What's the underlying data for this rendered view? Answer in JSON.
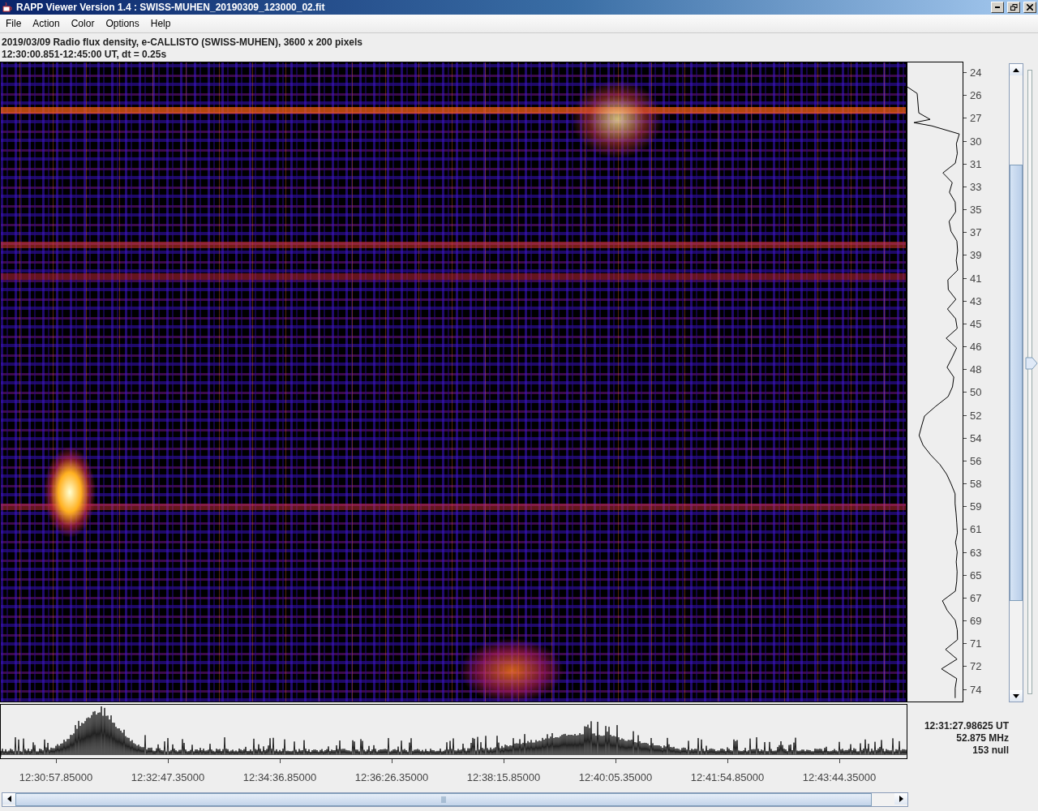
{
  "window": {
    "title": "RAPP Viewer Version 1.4 : SWISS-MUHEN_20190309_123000_02.fit"
  },
  "menu": [
    "File",
    "Action",
    "Color",
    "Options",
    "Help"
  ],
  "header": {
    "line_1": "2019/03/09  Radio flux density, e-CALLISTO (SWISS-MUHEN),  3600 x 200 pixels",
    "line_2": "12:30:00.851-12:45:00 UT,  dt = 0.25s"
  },
  "frequency_axis": [
    "24",
    "26",
    "27",
    "30",
    "31",
    "33",
    "35",
    "37",
    "39",
    "41",
    "43",
    "45",
    "46",
    "48",
    "50",
    "52",
    "54",
    "56",
    "58",
    "59",
    "61",
    "63",
    "65",
    "67",
    "69",
    "71",
    "72",
    "74"
  ],
  "contrast_slider": {
    "level": 0.53
  },
  "time_axis": [
    "12:30:57.85000",
    "12:32:47.35000",
    "12:34:36.85000",
    "12:36:26.35000",
    "12:38:15.85000",
    "12:40:05.35000",
    "12:41:54.85000",
    "12:43:44.35000"
  ],
  "readout": {
    "time": "12:31:27.98625 UT",
    "frequency": "52.875 MHz",
    "value": "153 null"
  }
}
